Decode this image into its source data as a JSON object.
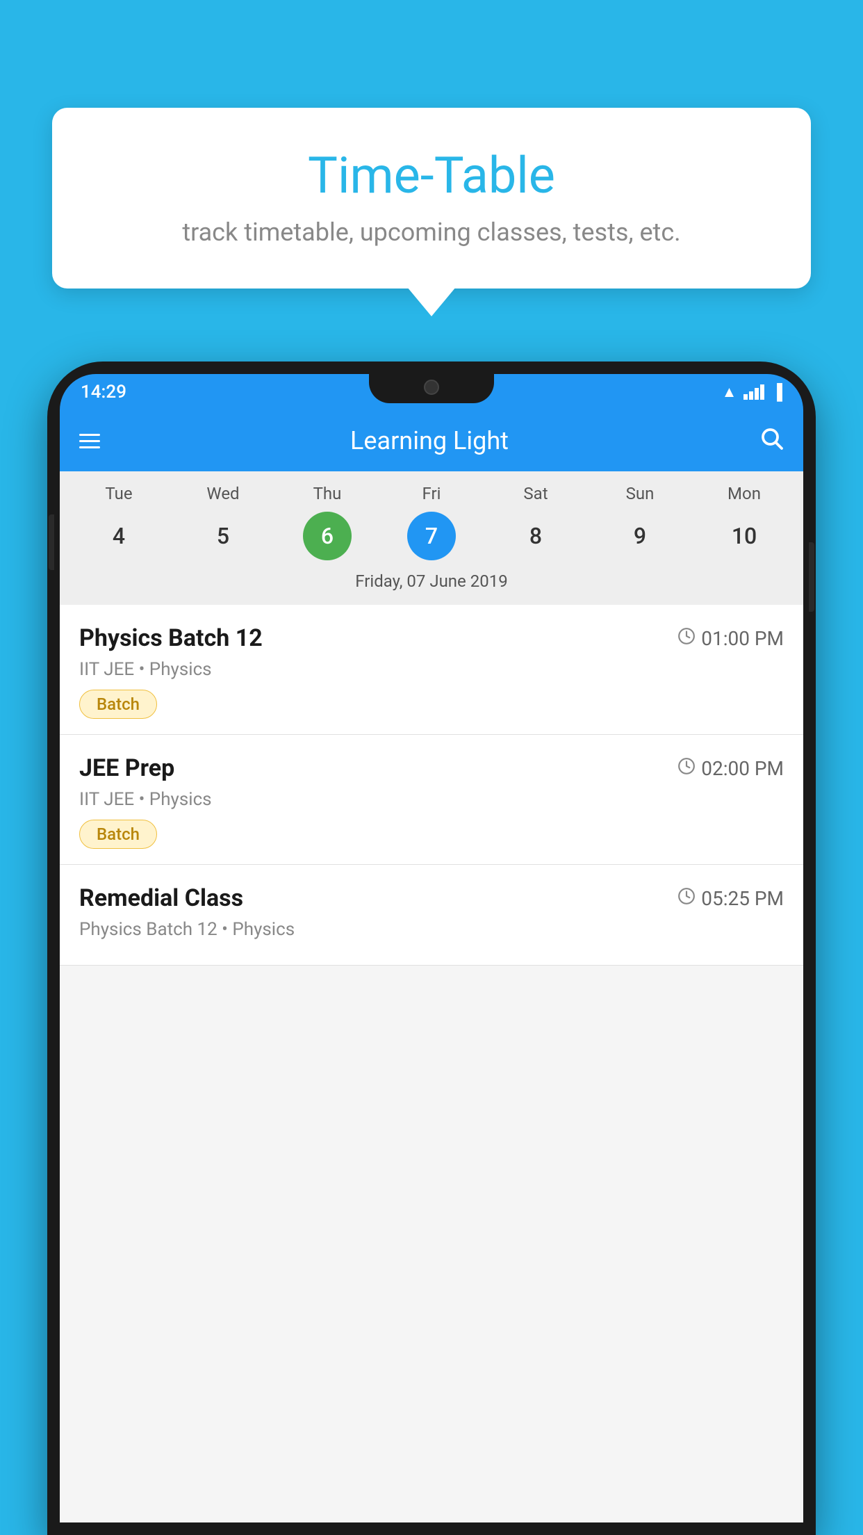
{
  "background": {
    "color": "#29b6e8"
  },
  "tooltip": {
    "title": "Time-Table",
    "subtitle": "track timetable, upcoming classes, tests, etc."
  },
  "phone": {
    "status_bar": {
      "time": "14:29"
    },
    "app_header": {
      "title": "Learning Light",
      "search_label": "search"
    },
    "calendar": {
      "days": [
        {
          "label": "Tue",
          "number": "4"
        },
        {
          "label": "Wed",
          "number": "5"
        },
        {
          "label": "Thu",
          "number": "6",
          "state": "today"
        },
        {
          "label": "Fri",
          "number": "7",
          "state": "selected"
        },
        {
          "label": "Sat",
          "number": "8"
        },
        {
          "label": "Sun",
          "number": "9"
        },
        {
          "label": "Mon",
          "number": "10"
        }
      ],
      "selected_date": "Friday, 07 June 2019"
    },
    "schedule": [
      {
        "title": "Physics Batch 12",
        "time": "01:00 PM",
        "subtitle": "IIT JEE • Physics",
        "badge": "Batch"
      },
      {
        "title": "JEE Prep",
        "time": "02:00 PM",
        "subtitle": "IIT JEE • Physics",
        "badge": "Batch"
      },
      {
        "title": "Remedial Class",
        "time": "05:25 PM",
        "subtitle": "Physics Batch 12 • Physics",
        "badge": ""
      }
    ]
  }
}
